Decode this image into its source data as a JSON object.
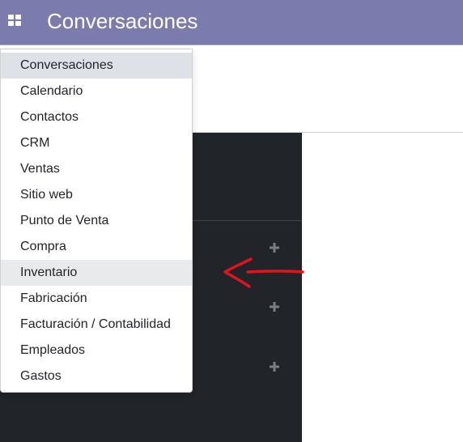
{
  "header": {
    "title": "Conversaciones",
    "apps_icon": "grid-icon"
  },
  "apps_menu": {
    "items": [
      {
        "label": "Conversaciones",
        "state": "active"
      },
      {
        "label": "Calendario"
      },
      {
        "label": "Contactos"
      },
      {
        "label": "CRM"
      },
      {
        "label": "Ventas"
      },
      {
        "label": "Sitio web"
      },
      {
        "label": "Punto de Venta"
      },
      {
        "label": "Compra"
      },
      {
        "label": "Inventario",
        "state": "hover"
      },
      {
        "label": "Fabricación"
      },
      {
        "label": "Facturación / Contabilidad"
      },
      {
        "label": "Empleados"
      },
      {
        "label": "Gastos"
      }
    ]
  },
  "colors": {
    "topbar": "#7c7bad",
    "sidebar": "#212529",
    "annotation": "#e0141e"
  },
  "annotation": {
    "icon": "red-arrow-pointing-left"
  }
}
